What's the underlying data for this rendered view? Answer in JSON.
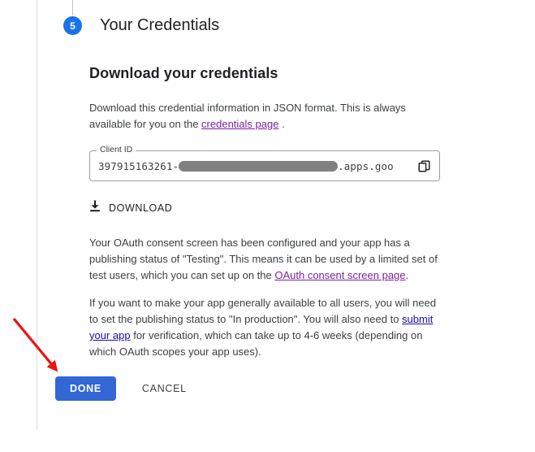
{
  "step": {
    "number": "5",
    "title": "Your Credentials"
  },
  "section": {
    "heading": "Download your credentials",
    "intro_before_link": "Download this credential information in JSON format. This is always available for you on the ",
    "intro_link": "credentials page",
    "intro_after_link": " ."
  },
  "client_id_field": {
    "legend": "Client ID",
    "value_prefix": "397915163261-",
    "value_redacted": "",
    "value_suffix": ".apps.goo",
    "copy_icon": "copy-icon"
  },
  "download_button": {
    "label": "DOWNLOAD",
    "icon": "download-icon"
  },
  "oauth_paragraph": {
    "before_link": "Your OAuth consent screen has been configured and your app has a publishing status of \"Testing\". This means it can be used by a limited set of test users, which you can set up on the ",
    "link": "OAuth consent screen page",
    "after_link": "."
  },
  "production_paragraph": {
    "before_link": "If you want to make your app generally available to all users, you will need to set the publishing status to \"In production\". You will also need to ",
    "link": "submit your app",
    "after_link": " for verification, which can take up to 4-6 weeks (depending on which OAuth scopes your app uses)."
  },
  "footer": {
    "done_label": "DONE",
    "cancel_label": "CANCEL"
  },
  "annotation": {
    "arrow": "red-arrow-pointing-to-done-button"
  },
  "colors": {
    "accent_blue": "#1a73e8",
    "button_blue": "#3367d6",
    "link_visited": "#7b1fa2",
    "link_blue": "#1a0dab",
    "annotation_red": "#ee1111",
    "redaction_gray": "#808080",
    "border_gray": "#dadce0"
  }
}
